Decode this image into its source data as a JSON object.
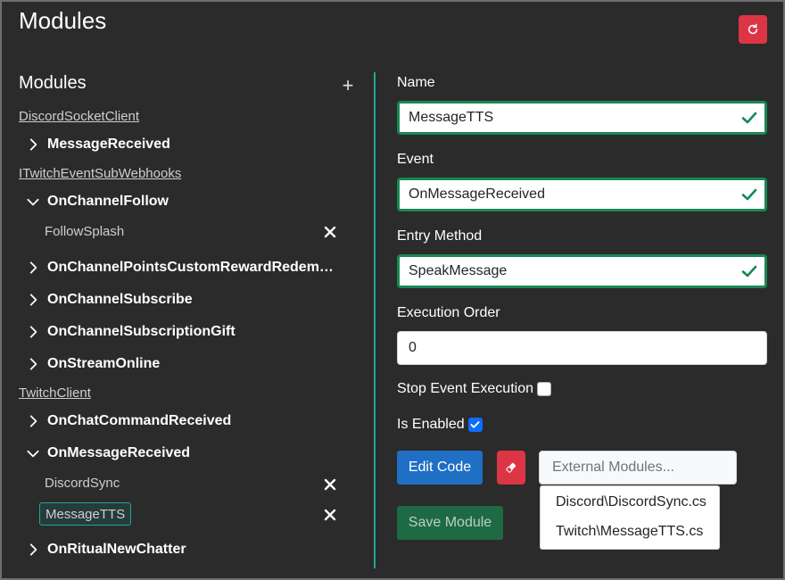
{
  "page": {
    "title": "Modules"
  },
  "header": {
    "reload_icon": "reload-icon"
  },
  "tree": {
    "heading": "Modules",
    "add_label": "+",
    "groups": [
      {
        "name": "DiscordSocketClient"
      },
      {
        "name": "ITwitchEventSubWebhooks"
      },
      {
        "name": "TwitchClient"
      }
    ],
    "events": [
      {
        "name": "MessageReceived",
        "expanded": false
      },
      {
        "name": "OnChannelFollow",
        "expanded": true
      },
      {
        "name": "OnChannelPointsCustomRewardRedem…",
        "expanded": false
      },
      {
        "name": "OnChannelSubscribe",
        "expanded": false
      },
      {
        "name": "OnChannelSubscriptionGift",
        "expanded": false
      },
      {
        "name": "OnStreamOnline",
        "expanded": false
      },
      {
        "name": "OnChatCommandReceived",
        "expanded": false
      },
      {
        "name": "OnMessageReceived",
        "expanded": true
      },
      {
        "name": "OnRitualNewChatter",
        "expanded": false
      }
    ],
    "modules": [
      {
        "name": "FollowSplash",
        "selected": false
      },
      {
        "name": "DiscordSync",
        "selected": false
      },
      {
        "name": "MessageTTS",
        "selected": true
      }
    ]
  },
  "form": {
    "name": {
      "label": "Name",
      "value": "MessageTTS"
    },
    "event": {
      "label": "Event",
      "value": "OnMessageReceived"
    },
    "entry_method": {
      "label": "Entry Method",
      "value": "SpeakMessage"
    },
    "execution_order": {
      "label": "Execution Order",
      "value": "0"
    },
    "stop_event_execution": {
      "label": "Stop Event Execution",
      "checked": false
    },
    "is_enabled": {
      "label": "Is Enabled",
      "checked": true
    },
    "edit_code_label": "Edit Code",
    "external_modules": {
      "placeholder": "External Modules...",
      "options": [
        "Discord\\DiscordSync.cs",
        "Twitch\\MessageTTS.cs"
      ]
    },
    "save_label": "Save Module"
  },
  "colors": {
    "background": "#2b2b2b",
    "accent_teal": "#1fa69a",
    "danger": "#dc3545",
    "primary": "#1f6fc5",
    "success": "#198754"
  }
}
